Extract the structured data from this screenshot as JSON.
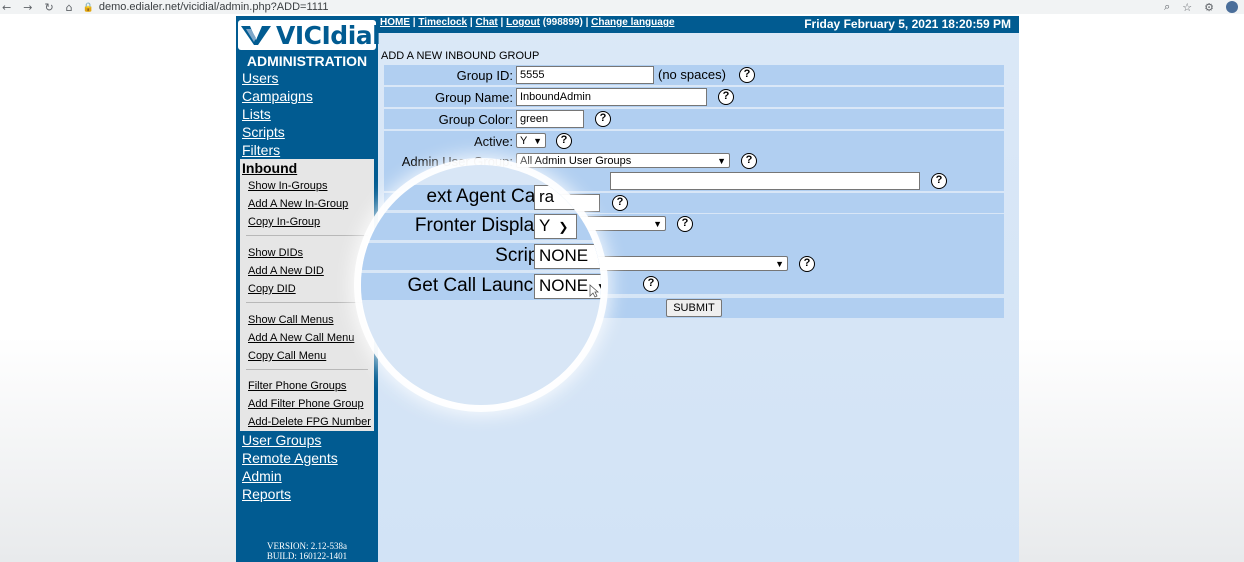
{
  "browser": {
    "url": "demo.edialer.net/vicidial/admin.php?ADD=1111",
    "back_icon": "arrow-left-icon",
    "forward_icon": "arrow-right-icon",
    "reload_icon": "reload-icon",
    "home_icon": "home-icon"
  },
  "logo": {
    "text": "VICIdial"
  },
  "sidebar": {
    "title": "ADMINISTRATION",
    "menu": [
      "Users",
      "Campaigns",
      "Lists",
      "Scripts",
      "Filters"
    ],
    "active_section": "Inbound",
    "inbound_links": [
      "Show In-Groups",
      "Add A New In-Group",
      "Copy In-Group",
      "Show DIDs",
      "Add A New DID",
      "Copy DID",
      "Show Call Menus",
      "Add A New Call Menu",
      "Copy Call Menu",
      "Filter Phone Groups",
      "Add Filter Phone Group",
      "Add-Delete FPG Number"
    ],
    "menu_after": [
      "User Groups",
      "Remote Agents",
      "Admin",
      "Reports"
    ],
    "version": "VERSION: 2.12-538a",
    "build": "BUILD: 160122-1401"
  },
  "header": {
    "home": "HOME",
    "timeclock": "Timeclock",
    "chat": "Chat",
    "logout": "Logout",
    "user_id": "(998899)",
    "change_language": "Change language",
    "sep": "|",
    "datetime": "Friday February 5, 2021 18:20:59 PM"
  },
  "form": {
    "title": "ADD A NEW INBOUND GROUP",
    "group_id": {
      "label": "Group ID:",
      "value": "5555",
      "note": "(no spaces)"
    },
    "group_name": {
      "label": "Group Name:",
      "value": "InboundAdmin"
    },
    "group_color": {
      "label": "Group Color:",
      "value": "green"
    },
    "active": {
      "label": "Active:",
      "value": "Y"
    },
    "admin_user_group": {
      "label": "Admin User Group:",
      "value": "All Admin User Groups"
    },
    "help_symbol": "?",
    "submit_label": "SUBMIT"
  },
  "magnifier": {
    "rows": [
      {
        "label": "ext Agent Call:",
        "value": "ra"
      },
      {
        "label": "Fronter Display:",
        "value": "Y"
      },
      {
        "label": "Script:",
        "value": "NONE"
      },
      {
        "label": "Get Call Launch:",
        "value": "NONE"
      }
    ]
  }
}
